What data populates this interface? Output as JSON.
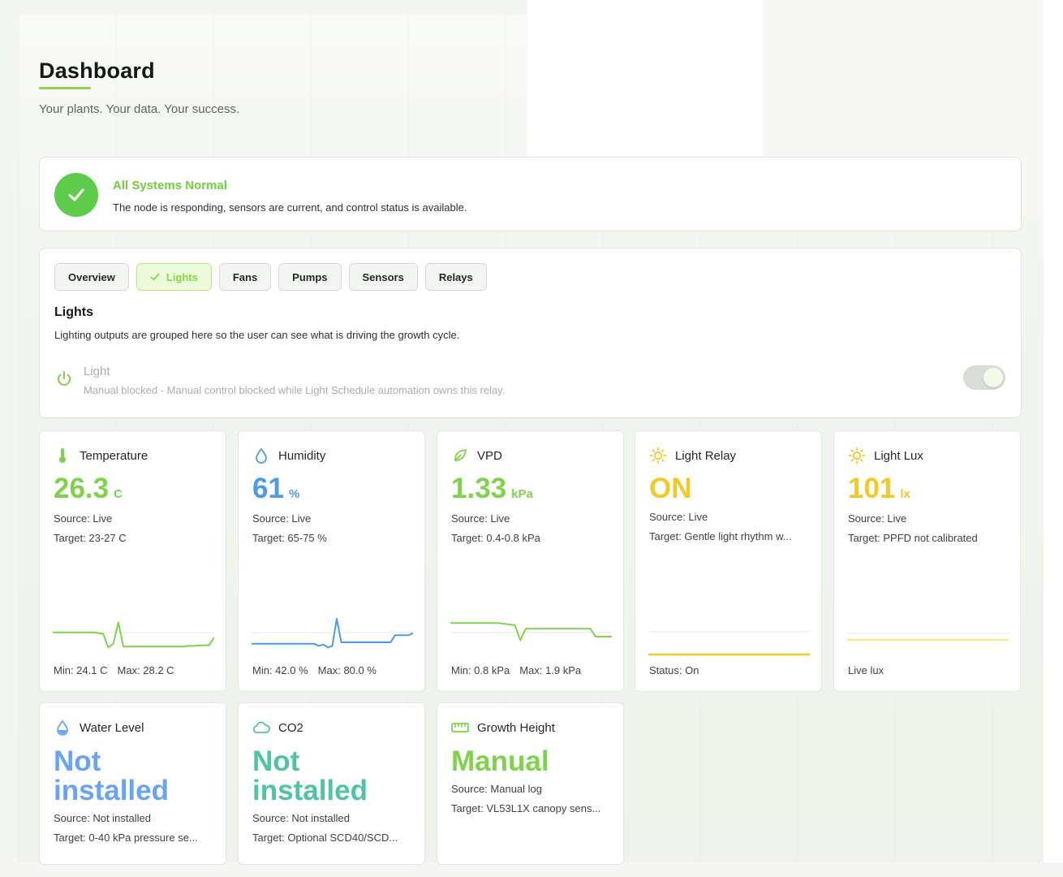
{
  "header": {
    "title": "Dashboard",
    "subtitle": "Your plants. Your data. Your success."
  },
  "status": {
    "title": "All Systems Normal",
    "description": "The node is responding, sensors are current, and control status is available.",
    "icon": "check-icon",
    "color": "#5fcb4a"
  },
  "tabs": [
    {
      "label": "Overview",
      "active": false
    },
    {
      "label": "Lights",
      "active": true
    },
    {
      "label": "Fans",
      "active": false
    },
    {
      "label": "Pumps",
      "active": false
    },
    {
      "label": "Sensors",
      "active": false
    },
    {
      "label": "Relays",
      "active": false
    }
  ],
  "section": {
    "title": "Lights",
    "description": "Lighting outputs are grouped here so the user can see what is driving the growth cycle.",
    "relay": {
      "name": "Light",
      "status": "Manual blocked - Manual control blocked while Light Schedule automation owns this relay.",
      "icon": "power-icon",
      "toggle_on": true
    }
  },
  "cards": {
    "temperature": {
      "title": "Temperature",
      "icon": "thermometer-icon",
      "color": "#7fd34a",
      "value": "26.3",
      "unit": "C",
      "source": "Source: Live",
      "target": "Target: 23-27 C",
      "min": "Min: 24.1 C",
      "max": "Max: 28.2 C",
      "series": [
        0.62,
        0.62,
        0.62,
        0.62,
        0.62,
        0.62,
        0.62,
        0.62,
        0.62,
        0.6,
        0.58,
        0.2,
        0.3,
        0.9,
        0.22,
        0.22,
        0.22,
        0.22,
        0.22,
        0.22,
        0.22,
        0.22,
        0.22,
        0.22,
        0.22,
        0.22,
        0.22,
        0.24,
        0.24,
        0.25,
        0.26,
        0.26,
        0.48
      ]
    },
    "humidity": {
      "title": "Humidity",
      "icon": "droplet-icon",
      "color": "#4d9be8",
      "value": "61",
      "unit": "%",
      "source": "Source: Live",
      "target": "Target: 65-75 %",
      "min": "Min: 42.0 %",
      "max": "Max: 80.0 %",
      "series": [
        0.3,
        0.3,
        0.3,
        0.3,
        0.3,
        0.3,
        0.3,
        0.3,
        0.3,
        0.3,
        0.3,
        0.3,
        0.3,
        0.3,
        0.3,
        0.24,
        0.28,
        0.2,
        0.24,
        1.0,
        0.34,
        0.34,
        0.34,
        0.34,
        0.34,
        0.34,
        0.34,
        0.34,
        0.34,
        0.34,
        0.34,
        0.34,
        0.54,
        0.54,
        0.54,
        0.54,
        0.6
      ]
    },
    "vpd": {
      "title": "VPD",
      "icon": "leaf-icon",
      "color": "#7fd34a",
      "value": "1.33",
      "unit": "kPa",
      "source": "Source: Live",
      "target": "Target: 0.4-0.8 kPa",
      "min": "Min: 0.8 kPa",
      "max": "Max: 1.9 kPa",
      "series": [
        0.88,
        0.88,
        0.88,
        0.88,
        0.88,
        0.88,
        0.88,
        0.88,
        0.88,
        0.88,
        0.86,
        0.84,
        0.82,
        0.4,
        0.72,
        0.72,
        0.72,
        0.72,
        0.72,
        0.72,
        0.72,
        0.72,
        0.72,
        0.72,
        0.72,
        0.72,
        0.72,
        0.5,
        0.5,
        0.5,
        0.5
      ]
    },
    "light_relay": {
      "title": "Light Relay",
      "icon": "sun-icon",
      "color": "#f3c927",
      "value": "ON",
      "source": "Source: Live",
      "target": "Target: Gentle light rhythm w...",
      "footer": "Status: On"
    },
    "light_lux": {
      "title": "Light Lux",
      "icon": "sun-icon",
      "color": "#f3c927",
      "value": "101",
      "unit": "lx",
      "source": "Source: Live",
      "target": "Target: PPFD not calibrated",
      "footer": "Live lux"
    },
    "water_level": {
      "title": "Water Level",
      "icon": "water-drop-icon",
      "color": "#6aa4f0",
      "value_line1": "Not",
      "value_line2": "installed",
      "source": "Source: Not installed",
      "target": "Target: 0-40 kPa pressure se..."
    },
    "co2": {
      "title": "CO2",
      "icon": "cloud-icon",
      "color": "#4fc3a6",
      "value_line1": "Not",
      "value_line2": "installed",
      "source": "Source: Not installed",
      "target": "Target: Optional SCD40/SCD..."
    },
    "growth_height": {
      "title": "Growth Height",
      "icon": "ruler-icon",
      "color": "#7fd34a",
      "value": "Manual",
      "source": "Source: Manual log",
      "target": "Target: VL53L1X canopy sens..."
    }
  }
}
